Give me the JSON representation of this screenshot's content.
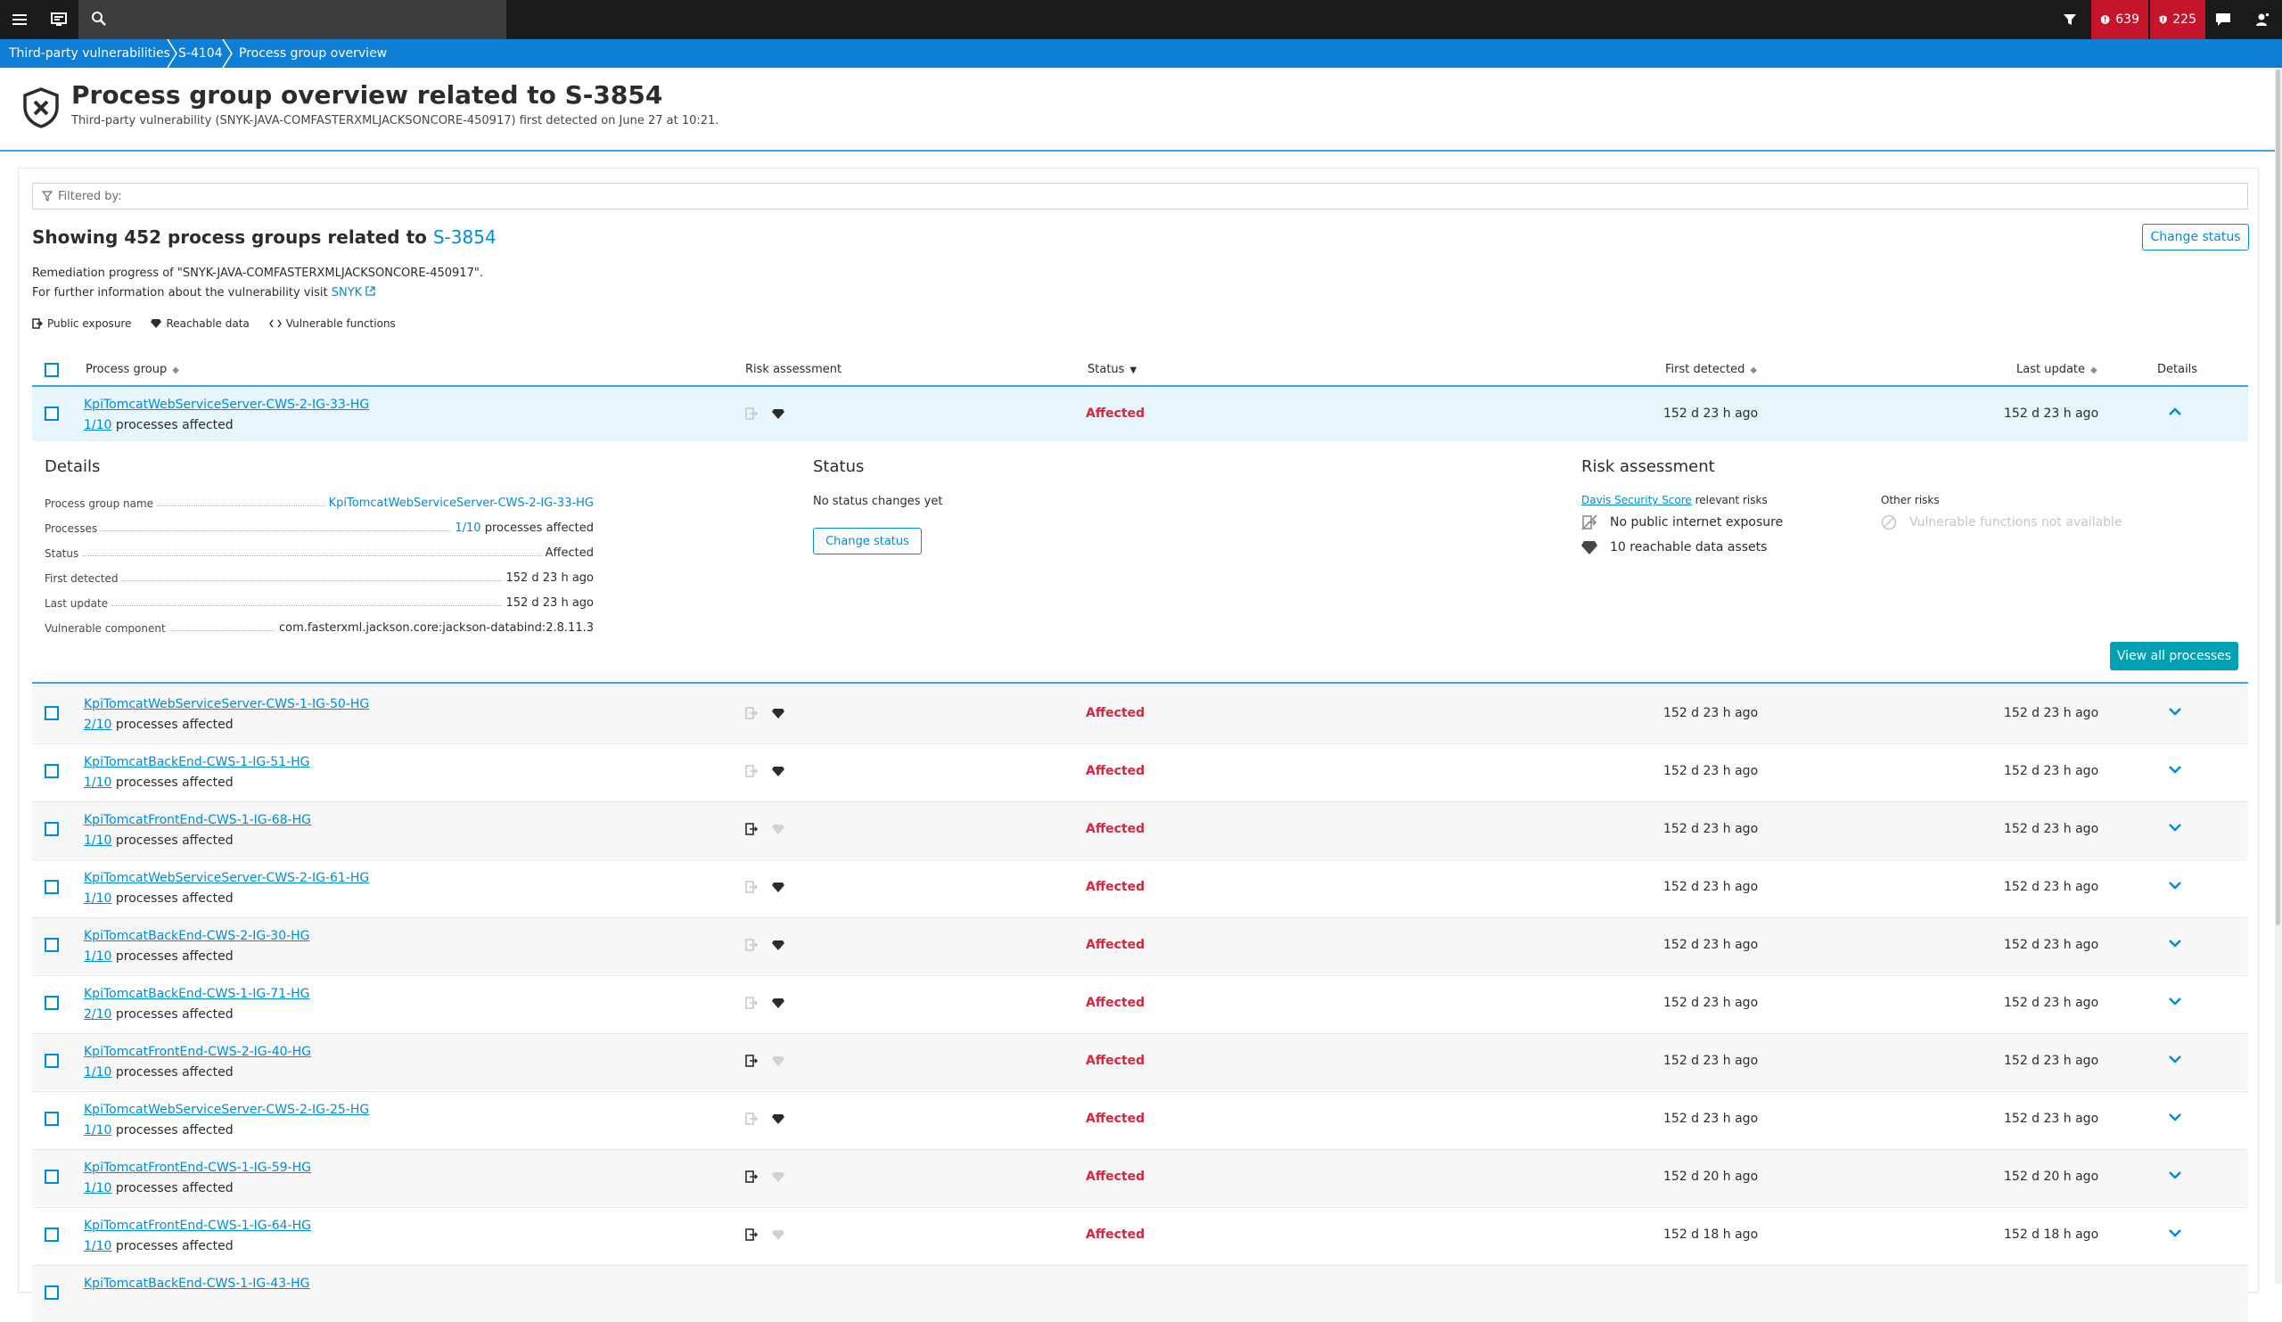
{
  "topbar": {
    "problems_count": "639",
    "vulnerabilities_count": "225"
  },
  "breadcrumb": [
    "Third-party vulnerabilities",
    "S-4104",
    "Process group overview"
  ],
  "header": {
    "title": "Process group overview related to S-3854",
    "subtitle": "Third-party vulnerability (SNYK-JAVA-COMFASTERXMLJACKSONCORE-450917) first detected on June 27 at 10:21."
  },
  "filter": {
    "placeholder": "Filtered by:"
  },
  "summary": {
    "showing_prefix": "Showing 452 process groups related to",
    "showing_link": "S-3854",
    "change_status_label": "Change status",
    "remediation_text": "Remediation progress of \"SNYK-JAVA-COMFASTERXMLJACKSONCORE-450917\".",
    "info_text": "For further information about the vulnerability visit",
    "info_link": "SNYK"
  },
  "legend": {
    "public_exposure": "Public exposure",
    "reachable_data": "Reachable data",
    "vulnerable_functions": "Vulnerable functions"
  },
  "table": {
    "columns": [
      "Process group",
      "Risk assessment",
      "Status",
      "First detected",
      "Last update",
      "Details"
    ],
    "processes_suffix": "processes affected",
    "rows": [
      {
        "name": "KpiTomcatWebServiceServer-CWS-2-IG-33-HG",
        "count": "1/10",
        "exposure": false,
        "reachable": true,
        "status": "Affected",
        "first": "152 d 23 h ago",
        "last": "152 d 23 h ago",
        "expanded": true
      },
      {
        "name": "KpiTomcatWebServiceServer-CWS-1-IG-50-HG",
        "count": "2/10",
        "exposure": false,
        "reachable": true,
        "status": "Affected",
        "first": "152 d 23 h ago",
        "last": "152 d 23 h ago"
      },
      {
        "name": "KpiTomcatBackEnd-CWS-1-IG-51-HG",
        "count": "1/10",
        "exposure": false,
        "reachable": true,
        "status": "Affected",
        "first": "152 d 23 h ago",
        "last": "152 d 23 h ago"
      },
      {
        "name": "KpiTomcatFrontEnd-CWS-1-IG-68-HG",
        "count": "1/10",
        "exposure": true,
        "reachable": false,
        "status": "Affected",
        "first": "152 d 23 h ago",
        "last": "152 d 23 h ago"
      },
      {
        "name": "KpiTomcatWebServiceServer-CWS-2-IG-61-HG",
        "count": "1/10",
        "exposure": false,
        "reachable": true,
        "status": "Affected",
        "first": "152 d 23 h ago",
        "last": "152 d 23 h ago"
      },
      {
        "name": "KpiTomcatBackEnd-CWS-2-IG-30-HG",
        "count": "1/10",
        "exposure": false,
        "reachable": true,
        "status": "Affected",
        "first": "152 d 23 h ago",
        "last": "152 d 23 h ago"
      },
      {
        "name": "KpiTomcatBackEnd-CWS-1-IG-71-HG",
        "count": "2/10",
        "exposure": false,
        "reachable": true,
        "status": "Affected",
        "first": "152 d 23 h ago",
        "last": "152 d 23 h ago"
      },
      {
        "name": "KpiTomcatFrontEnd-CWS-2-IG-40-HG",
        "count": "1/10",
        "exposure": true,
        "reachable": false,
        "status": "Affected",
        "first": "152 d 23 h ago",
        "last": "152 d 23 h ago"
      },
      {
        "name": "KpiTomcatWebServiceServer-CWS-2-IG-25-HG",
        "count": "1/10",
        "exposure": false,
        "reachable": true,
        "status": "Affected",
        "first": "152 d 23 h ago",
        "last": "152 d 23 h ago"
      },
      {
        "name": "KpiTomcatFrontEnd-CWS-1-IG-59-HG",
        "count": "1/10",
        "exposure": true,
        "reachable": false,
        "status": "Affected",
        "first": "152 d 20 h ago",
        "last": "152 d 20 h ago"
      },
      {
        "name": "KpiTomcatFrontEnd-CWS-1-IG-64-HG",
        "count": "1/10",
        "exposure": true,
        "reachable": false,
        "status": "Affected",
        "first": "152 d 18 h ago",
        "last": "152 d 18 h ago"
      },
      {
        "name": "KpiTomcatBackEnd-CWS-1-IG-43-HG",
        "count": "",
        "exposure": false,
        "reachable": true,
        "status": "",
        "first": "",
        "last": ""
      }
    ]
  },
  "details": {
    "title": "Details",
    "fields": [
      {
        "key": "Process group name",
        "value": "KpiTomcatWebServiceServer-CWS-2-IG-33-HG",
        "link": true
      },
      {
        "key": "Processes",
        "value_link": "1/10",
        "value": "processes affected"
      },
      {
        "key": "Status",
        "value": "Affected"
      },
      {
        "key": "First detected",
        "value": "152 d 23 h ago"
      },
      {
        "key": "Last update",
        "value": "152 d 23 h ago"
      },
      {
        "key": "Vulnerable component",
        "value": "com.fasterxml.jackson.core:jackson-databind:2.8.11.3"
      }
    ],
    "status_title": "Status",
    "status_text": "No status changes yet",
    "change_status_label": "Change status",
    "risk_title": "Risk assessment",
    "davis_link": "Davis Security Score",
    "relevant_risks": "relevant risks",
    "other_risks": "Other risks",
    "no_exposure": "No public internet exposure",
    "reachable_assets": "10 reachable data assets",
    "vuln_functions": "Vulnerable functions not available",
    "view_all_label": "View all processes"
  },
  "colors": {
    "link": "#008cdb",
    "affected": "#d7263d",
    "breadcrumb": "#0f7fd6",
    "primary_button": "#00a1b2",
    "alert": "#c4152a"
  }
}
